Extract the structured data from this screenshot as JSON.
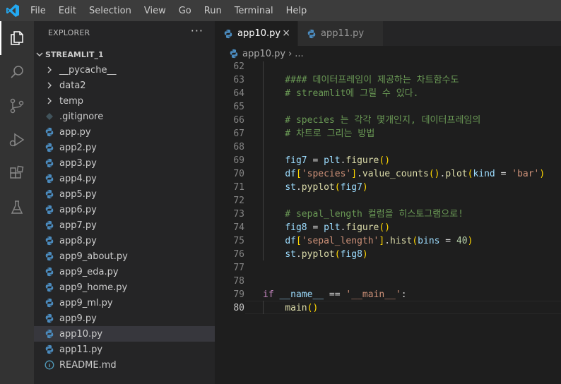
{
  "menu": [
    "File",
    "Edit",
    "Selection",
    "View",
    "Go",
    "Run",
    "Terminal",
    "Help"
  ],
  "activity_icons": [
    "explorer-icon",
    "search-icon",
    "source-control-icon",
    "run-debug-icon",
    "extensions-icon",
    "testing-icon"
  ],
  "explorer": {
    "header": "EXPLORER",
    "more": "···",
    "project": "STREAMLIT_1",
    "items": [
      {
        "label": "__pycache__",
        "kind": "folder"
      },
      {
        "label": "data2",
        "kind": "folder"
      },
      {
        "label": "temp",
        "kind": "folder"
      },
      {
        "label": ".gitignore",
        "kind": "git"
      },
      {
        "label": "app.py",
        "kind": "py"
      },
      {
        "label": "app2.py",
        "kind": "py"
      },
      {
        "label": "app3.py",
        "kind": "py"
      },
      {
        "label": "app4.py",
        "kind": "py"
      },
      {
        "label": "app5.py",
        "kind": "py"
      },
      {
        "label": "app6.py",
        "kind": "py"
      },
      {
        "label": "app7.py",
        "kind": "py"
      },
      {
        "label": "app8.py",
        "kind": "py"
      },
      {
        "label": "app9_about.py",
        "kind": "py"
      },
      {
        "label": "app9_eda.py",
        "kind": "py"
      },
      {
        "label": "app9_home.py",
        "kind": "py"
      },
      {
        "label": "app9_ml.py",
        "kind": "py"
      },
      {
        "label": "app9.py",
        "kind": "py"
      },
      {
        "label": "app10.py",
        "kind": "py",
        "selected": true
      },
      {
        "label": "app11.py",
        "kind": "py"
      },
      {
        "label": "README.md",
        "kind": "info"
      }
    ]
  },
  "tabs": [
    {
      "label": "app10.py",
      "active": true,
      "close": "×"
    },
    {
      "label": "app11.py",
      "active": false
    }
  ],
  "breadcrumb": {
    "file": "app10.py",
    "sep": "›",
    "rest": "..."
  },
  "editor": {
    "lines": [
      {
        "n": "62",
        "t": []
      },
      {
        "n": "63",
        "t": [
          [
            "    #### 데이터프레임이 제공하는 차트함수도",
            "cm"
          ]
        ]
      },
      {
        "n": "64",
        "t": [
          [
            "    # streamlit에 그릴 수 있다.",
            "cm"
          ]
        ]
      },
      {
        "n": "65",
        "t": []
      },
      {
        "n": "66",
        "t": [
          [
            "    # species 는 각각 몇개인지, 데이터프레임의",
            "cm"
          ]
        ]
      },
      {
        "n": "67",
        "t": [
          [
            "    # 차트로 그리는 방법",
            "cm"
          ]
        ]
      },
      {
        "n": "68",
        "t": []
      },
      {
        "n": "69",
        "t": [
          [
            "    ",
            "op"
          ],
          [
            "fig7",
            "vr"
          ],
          [
            " = ",
            "op"
          ],
          [
            "plt",
            "vr"
          ],
          [
            ".",
            "op"
          ],
          [
            "figure",
            "fn"
          ],
          [
            "()",
            "p1"
          ]
        ]
      },
      {
        "n": "70",
        "t": [
          [
            "    ",
            "op"
          ],
          [
            "df",
            "vr"
          ],
          [
            "[",
            "p1"
          ],
          [
            "'species'",
            "str"
          ],
          [
            "]",
            "p1"
          ],
          [
            ".",
            "op"
          ],
          [
            "value_counts",
            "fn"
          ],
          [
            "()",
            "p1"
          ],
          [
            ".",
            "op"
          ],
          [
            "plot",
            "fn"
          ],
          [
            "(",
            "p1"
          ],
          [
            "kind",
            "vr"
          ],
          [
            " = ",
            "op"
          ],
          [
            "'bar'",
            "str"
          ],
          [
            ")",
            "p1"
          ]
        ]
      },
      {
        "n": "71",
        "t": [
          [
            "    ",
            "op"
          ],
          [
            "st",
            "vr"
          ],
          [
            ".",
            "op"
          ],
          [
            "pyplot",
            "fn"
          ],
          [
            "(",
            "p1"
          ],
          [
            "fig7",
            "vr"
          ],
          [
            ")",
            "p1"
          ]
        ]
      },
      {
        "n": "72",
        "t": []
      },
      {
        "n": "73",
        "t": [
          [
            "    # sepal_length 컬럼을 히스토그램으로!",
            "cm"
          ]
        ]
      },
      {
        "n": "74",
        "t": [
          [
            "    ",
            "op"
          ],
          [
            "fig8",
            "vr"
          ],
          [
            " = ",
            "op"
          ],
          [
            "plt",
            "vr"
          ],
          [
            ".",
            "op"
          ],
          [
            "figure",
            "fn"
          ],
          [
            "()",
            "p1"
          ]
        ]
      },
      {
        "n": "75",
        "t": [
          [
            "    ",
            "op"
          ],
          [
            "df",
            "vr"
          ],
          [
            "[",
            "p1"
          ],
          [
            "'sepal_length'",
            "str"
          ],
          [
            "]",
            "p1"
          ],
          [
            ".",
            "op"
          ],
          [
            "hist",
            "fn"
          ],
          [
            "(",
            "p1"
          ],
          [
            "bins",
            "vr"
          ],
          [
            " = ",
            "op"
          ],
          [
            "40",
            "num"
          ],
          [
            ")",
            "p1"
          ]
        ]
      },
      {
        "n": "76",
        "t": [
          [
            "    ",
            "op"
          ],
          [
            "st",
            "vr"
          ],
          [
            ".",
            "op"
          ],
          [
            "pyplot",
            "fn"
          ],
          [
            "(",
            "p1"
          ],
          [
            "fig8",
            "vr"
          ],
          [
            ")",
            "p1"
          ]
        ]
      },
      {
        "n": "77",
        "t": []
      },
      {
        "n": "78",
        "t": []
      },
      {
        "n": "79",
        "t": [
          [
            "if",
            "kw"
          ],
          [
            " ",
            "op"
          ],
          [
            "__name__",
            "vr"
          ],
          [
            " == ",
            "op"
          ],
          [
            "'__main__'",
            "str"
          ],
          [
            ":",
            "op"
          ]
        ]
      },
      {
        "n": "80",
        "t": [
          [
            "    ",
            "op"
          ],
          [
            "main",
            "fn"
          ],
          [
            "()",
            "p1"
          ]
        ],
        "current": true
      }
    ]
  },
  "colors": {
    "accent": "#007acc",
    "python_icon": "#4b8bbe",
    "selected": "#37373d"
  }
}
